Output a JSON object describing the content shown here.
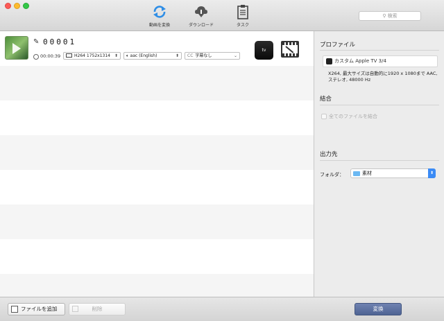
{
  "toolbar": {
    "convert_label": "動画を変換",
    "download_label": "ダウンロード",
    "task_label": "タスク",
    "search_placeholder": "検索"
  },
  "file": {
    "name": "00001",
    "duration": "00:00:39",
    "video_track": "H264 1752x1314",
    "audio_track": "aac (English)",
    "subtitle_track": "字幕なし",
    "device_label": "tv"
  },
  "panel": {
    "profile_title": "プロファイル",
    "profile_name": "カスタム Apple TV 3/4",
    "profile_desc": "X264, 最大サイズは自動的に1920 x 1080まで AAC, ステレオ, 48000 Hz",
    "merge_title": "結合",
    "merge_label": "全てのファイルを結合",
    "output_title": "出力先",
    "folder_label": "フォルダ：",
    "folder_value": "素材"
  },
  "bottom": {
    "add_label": "ファイルを追加",
    "delete_label": "削除",
    "convert_label": "変換"
  }
}
